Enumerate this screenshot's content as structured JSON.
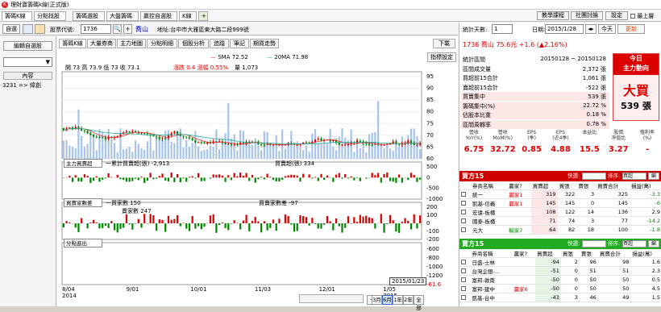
{
  "app": {
    "title": "理財寶籌碼k線(正式版)",
    "tabs": [
      "籌碼K線",
      "分點找股",
      "籌碼選股",
      "大盤籌碼",
      "贏控自選股",
      "K線"
    ],
    "right_buttons": [
      "教學課程",
      "社團討論",
      "設定",
      "最上層"
    ]
  },
  "toolbar": {
    "self_btn": "自選",
    "stock_code_label": "股票代號:",
    "stock_code_value": "1736",
    "stock_name": "喬山",
    "address": "地址:台中市大雅區東大路二段999號"
  },
  "left": {
    "edit_button": "編輯自選股",
    "content_label": "內容",
    "items": [
      "3231 => 緯創"
    ]
  },
  "chart": {
    "subtabs": [
      "籌碼K線",
      "大量券商",
      "主力地圖",
      "分點明細",
      "個股分析",
      "追蹤",
      "筆記",
      "期貨走勢"
    ],
    "download": "下載",
    "indicator": "指標設定",
    "ohlc": "開 73  高 73.9  低 73  收 73.1",
    "change": "漲跌 0.4  漲幅  0.55%",
    "volume": "量 1,073",
    "sma": "SMA 72.52",
    "ma20": "20MA 71.98",
    "price_ticks": [
      "95",
      "90",
      "85",
      "80",
      "75",
      "70",
      "65",
      "60"
    ],
    "panel2_select": "主力買賣超",
    "panel2_legend1": "一累計買賣超(張) -2,913",
    "panel2_legend2": "買賣超(張) 334",
    "panel2_ticks": [
      "500",
      "0",
      "-500",
      "-1000"
    ],
    "panel3_select": "買賣家數差",
    "panel3_legend1": "一買家數 150",
    "panel3_legend2": "買賣家數差 -97",
    "panel3_legend3": "賣家數 247",
    "panel3_ticks": [
      "200",
      "100",
      "0",
      "-100",
      "-200"
    ],
    "panel4_select": "分點進出",
    "panel4_ticks": [
      "-600",
      "-800",
      "-1000",
      "-1200",
      "-61.6"
    ],
    "x_ticks": [
      "8/04\n2014",
      "9/01",
      "10/01",
      "11/03",
      "12/01",
      "1/05\n2015"
    ],
    "date_badge": "2015/01/23",
    "zoom_buttons": [
      "3月",
      "6月",
      "1年",
      "2年",
      "全部"
    ],
    "selected_zoom": "6月",
    "price_range": [
      60,
      95
    ],
    "panel2_range": [
      -1000,
      500
    ],
    "panel3_range": [
      -200,
      200
    ],
    "chart_data": {
      "type": "candlestick",
      "ylim": [
        60,
        95
      ],
      "note": "K-line with buy/sell volume sub-panels"
    }
  },
  "right": {
    "days_label": "統計天數:",
    "days_value": "1",
    "date_label": "日期:",
    "date_value": "2015/1/28",
    "today_btn": "今天",
    "refresh_btn": "更新",
    "stock_header": "1736 喬山  75.6元  +1.6 (▲2.16%)",
    "stats": [
      {
        "k": "統計區間",
        "v": "20150128 ~ 20150128"
      },
      {
        "k": "區間成交量",
        "v": "2,372 張"
      },
      {
        "k": "買超前15合計",
        "v": "1,061 張"
      },
      {
        "k": "賣超前15合計",
        "v": "-522 張"
      },
      {
        "k": "買賣集中",
        "v": "539 張"
      },
      {
        "k": "籌碼集中(%)",
        "v": "22.72 %"
      },
      {
        "k": "佔股本比重",
        "v": "0.18 %"
      },
      {
        "k": "區間周轉率",
        "v": "0.78 %"
      }
    ],
    "today_box_title": "今日\n主力動向",
    "today_box_big": "大買",
    "today_box_val": "539 張",
    "metrics": [
      {
        "label": "營收\nYoY(%)",
        "value": "6.75"
      },
      {
        "label": "營收\nMoM(%)",
        "value": "32.72"
      },
      {
        "label": "EPS\n(季)",
        "value": "0.85"
      },
      {
        "label": "EPS\n(近4季)",
        "value": "4.88"
      },
      {
        "label": "本益比",
        "value": "15.5"
      },
      {
        "label": "股價\n淨值比",
        "value": "3.27"
      },
      {
        "label": "殖利率\n(%)",
        "value": "-"
      }
    ],
    "buy_title": "買方15",
    "sell_title": "賣方15",
    "filter_label": "快選:",
    "sort_label": "排序:",
    "sort_value": "買超",
    "table_headers": [
      "券商名稱",
      "贏家?",
      "買賣超",
      "買張",
      "賣張",
      "買賣合計",
      "損益(萬)"
    ],
    "buy_rows": [
      [
        "統一",
        "贏家1",
        "319",
        "322",
        "3",
        "325",
        "-3.3"
      ],
      [
        "凱基-信義",
        "贏家1",
        "145",
        "145",
        "0",
        "145",
        "-6"
      ],
      [
        "宏遠-板橋",
        "",
        "108",
        "122",
        "14",
        "136",
        "2.9"
      ],
      [
        "國泰-板橋",
        "",
        "71",
        "74",
        "3",
        "77",
        "-14.2"
      ],
      [
        "元大",
        "輸家7",
        "64",
        "82",
        "18",
        "100",
        "-1.8"
      ]
    ],
    "sell_rows": [
      [
        "日盛-士林",
        "",
        "-94",
        "2",
        "96",
        "98",
        "1.6"
      ],
      [
        "台灣企銀-...",
        "",
        "-51",
        "0",
        "51",
        "51",
        "2.3"
      ],
      [
        "富邦-敦南",
        "",
        "-50",
        "0",
        "50",
        "50",
        "0.5"
      ],
      [
        "富邦-建中",
        "贏家6",
        "-50",
        "0",
        "50",
        "50",
        "4.5"
      ],
      [
        "凱基-台中",
        "",
        "-43",
        "3",
        "46",
        "49",
        "1.5"
      ]
    ]
  }
}
